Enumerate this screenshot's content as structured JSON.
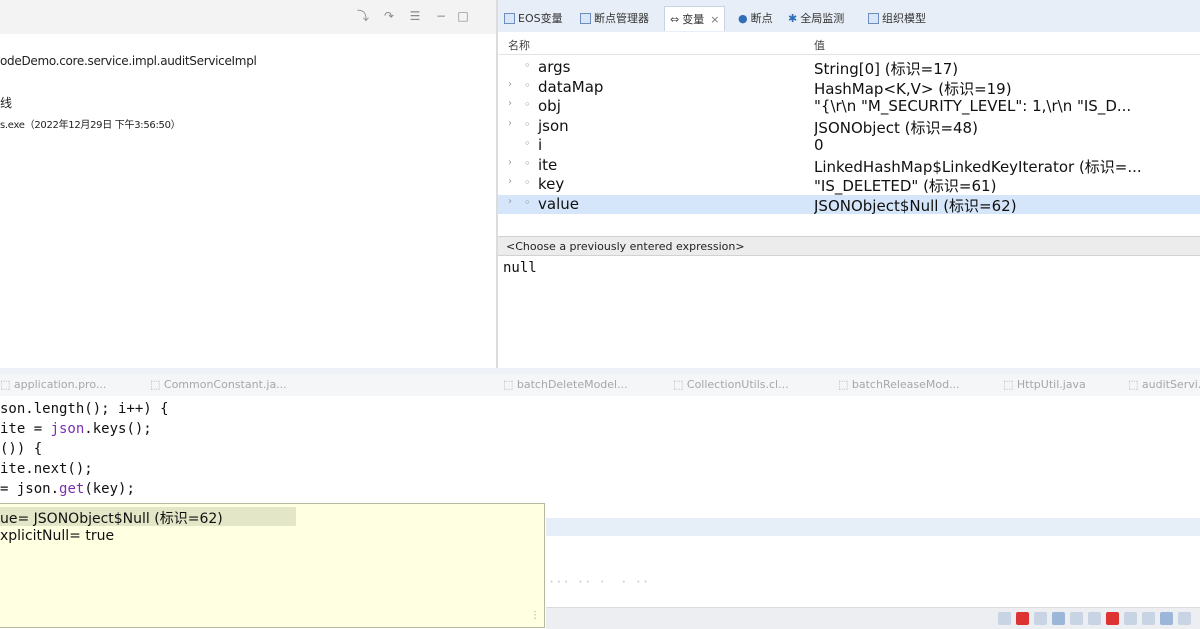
{
  "left_pane": {
    "lines": [
      {
        "text": "odeDemo.core.service.impl.auditServiceImpl"
      },
      {
        "text": "线"
      },
      {
        "text": "s.exe（2022年12月29日 下午3:56:50）"
      }
    ]
  },
  "views": {
    "tabs": [
      {
        "label": "EOS变量"
      },
      {
        "label": "断点管理器"
      },
      {
        "label": "变量"
      },
      {
        "label": "断点"
      },
      {
        "label": "全局监测"
      },
      {
        "label": "组织模型"
      }
    ]
  },
  "variables": {
    "columns": {
      "name": "名称",
      "value": "值"
    },
    "rows": [
      {
        "name": "args",
        "value": "String[0]  (标识=17)"
      },
      {
        "name": "dataMap",
        "value": "HashMap<K,V>  (标识=19)"
      },
      {
        "name": "obj",
        "value": "\"{\\r\\n   \"M_SECURITY_LEVEL\": 1,\\r\\n   \"IS_D..."
      },
      {
        "name": "json",
        "value": "JSONObject  (标识=48)"
      },
      {
        "name": "i",
        "value": "0"
      },
      {
        "name": "ite",
        "value": "LinkedHashMap$LinkedKeyIterator  (标识=..."
      },
      {
        "name": "key",
        "value": "\"IS_DELETED\"  (标识=61)"
      },
      {
        "name": "value",
        "value": "JSONObject$Null  (标识=62)"
      }
    ],
    "expression_placeholder": "<Choose a previously entered expression>",
    "expression_output": "null"
  },
  "editor_tabs": [
    {
      "label": "application.pro..."
    },
    {
      "label": "CommonConstant.ja..."
    },
    {
      "label": "batchDeleteModel..."
    },
    {
      "label": "CollectionUtils.cl..."
    },
    {
      "label": "batchReleaseMod..."
    },
    {
      "label": "HttpUtil.java"
    },
    {
      "label": "auditServi..."
    }
  ],
  "code": {
    "l1_a": "son.length(); i++) {",
    "l2_a": "ite = ",
    "l2_b": "json",
    "l2_c": ".keys();",
    "l3_a": "()) {",
    "l4_a": "ite.next();",
    "l5_a": "= json.",
    "l5_b": "get",
    "l5_c": "(key);"
  },
  "popup": {
    "line1": "ue= JSONObject$Null  (标识=62)",
    "line2": "xplicitNull= true"
  },
  "colors": {
    "selection": "#d6e6fa",
    "popup_bg": "#ffffe1",
    "tabbar_bg": "#e8eef7"
  }
}
